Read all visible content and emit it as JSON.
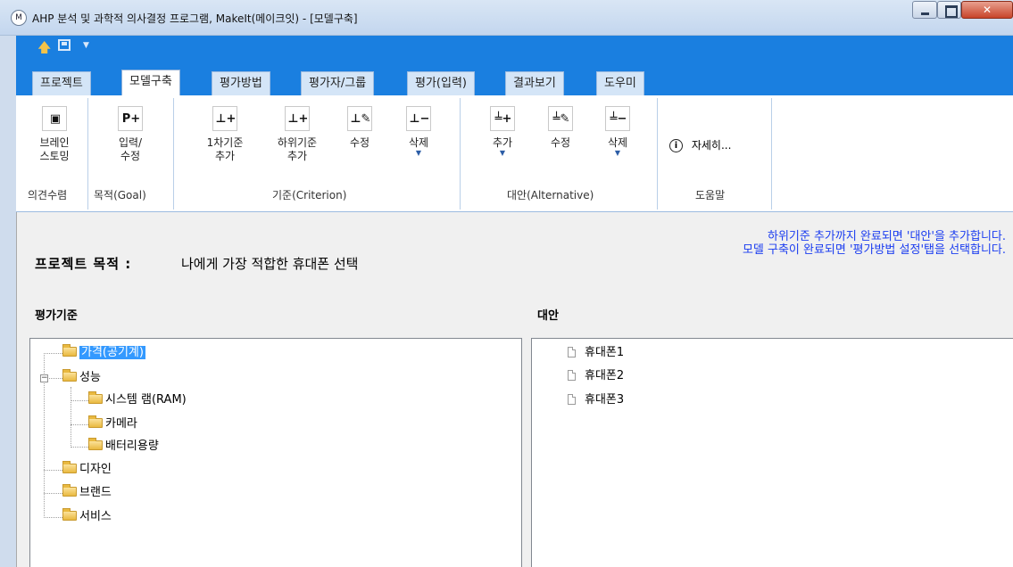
{
  "window": {
    "title": "AHP 분석 및 과학적 의사결정 프로그램, MakeIt(메이크잇) - [모델구축]",
    "app_icon": "M"
  },
  "quick_access": [
    "arrow-up-icon",
    "save-icon",
    "dropdown-icon"
  ],
  "tabs": [
    {
      "label": "프로젝트"
    },
    {
      "label": "모델구축",
      "active": true
    },
    {
      "label": "평가방법"
    },
    {
      "label": "평가자/그룹"
    },
    {
      "label": "평가(입력)"
    },
    {
      "label": "결과보기"
    },
    {
      "label": "도우미"
    }
  ],
  "ribbon": {
    "groups": {
      "opinion": "의견수렴",
      "goal": "목적(Goal)",
      "criterion": "기준(Criterion)",
      "alternative": "대안(Alternative)",
      "help": "도움말"
    },
    "buttons": {
      "brainstorm": {
        "line1": "브레인",
        "line2": "스토밍",
        "glyph": "▣"
      },
      "goal_input": {
        "line1": "입력/",
        "line2": "수정",
        "glyph": "P+"
      },
      "crit_add1": {
        "line1": "1차기준",
        "line2": "추가",
        "glyph": "⊥+"
      },
      "crit_addsub": {
        "line1": "하위기준",
        "line2": "추가",
        "glyph": "⊥+"
      },
      "crit_edit": {
        "line1": "수정",
        "glyph": "⊥✎"
      },
      "crit_delete": {
        "line1": "삭제",
        "glyph": "⊥−"
      },
      "alt_add": {
        "line1": "추가",
        "glyph": "╧+"
      },
      "alt_edit": {
        "line1": "수정",
        "glyph": "╧✎"
      },
      "alt_delete": {
        "line1": "삭제",
        "glyph": "╧−"
      },
      "details": {
        "label": "자세히..."
      }
    }
  },
  "content": {
    "hint_line1": "하위기준 추가까지 완료되면 '대안'을 추가합니다.",
    "hint_line2": "모델 구축이 완료되면 '평가방법 설정'탭을 선택합니다.",
    "goal_label": "프로젝트 목적 :",
    "goal_value": "나에게 가장 적합한 휴대폰 선택",
    "criteria_heading": "평가기준",
    "alternatives_heading": "대안",
    "criteria_tree": [
      {
        "label": "가격(공기계)",
        "selected": true
      },
      {
        "label": "성능",
        "expanded": true
      },
      {
        "label": "시스템 램(RAM)"
      },
      {
        "label": "카메라"
      },
      {
        "label": "배터리용량"
      },
      {
        "label": "디자인"
      },
      {
        "label": "브랜드"
      },
      {
        "label": "서비스"
      }
    ],
    "alternatives": [
      "휴대폰1",
      "휴대폰2",
      "휴대폰3"
    ],
    "expander_minus": "−"
  }
}
